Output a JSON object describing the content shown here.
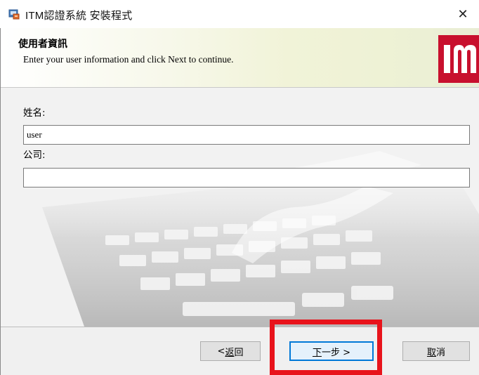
{
  "window": {
    "title": "ITM認證系統 安裝程式",
    "close_glyph": "✕"
  },
  "header": {
    "title": "使用者資訊",
    "subtitle": "Enter your user information and click Next to continue."
  },
  "form": {
    "name_label": "姓名:",
    "name_value": "user",
    "company_label": "公司:",
    "company_value": ""
  },
  "footer": {
    "back_prefix": "< ",
    "back_hotkey": "返",
    "back_rest": "回",
    "next_hotkey": "下",
    "next_rest": "一步 >",
    "cancel_hotkey": "取",
    "cancel_rest": "消"
  },
  "colors": {
    "brand_red": "#c8102e",
    "highlight": "#e8131b",
    "focus_blue": "#0078d7"
  },
  "icons": {
    "app": "installer-icon",
    "logo": "itm-logo",
    "close": "close-icon"
  }
}
